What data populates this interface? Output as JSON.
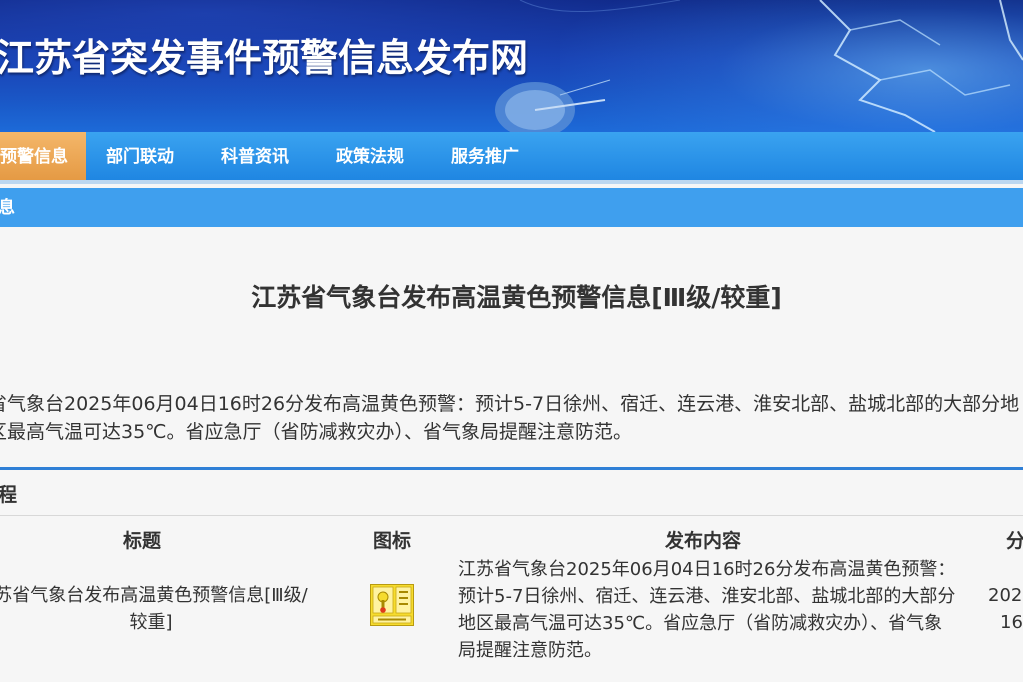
{
  "site": {
    "title": "江苏省突发事件预警信息发布网"
  },
  "nav": {
    "items": [
      {
        "label": "预警信息",
        "active": true
      },
      {
        "label": "部门联动",
        "active": false
      },
      {
        "label": "科普资讯",
        "active": false
      },
      {
        "label": "政策法规",
        "active": false
      },
      {
        "label": "服务推广",
        "active": false
      }
    ]
  },
  "subbar": {
    "label": "息"
  },
  "article": {
    "title": "江苏省气象台发布高温黄色预警信息[Ⅲ级/较重]",
    "body": "省气象台2025年06月04日16时26分发布高温黄色预警：预计5-7日徐州、宿迁、连云港、淮安北部、盐城北部的大部分地区最高气温可达35℃。省应急厅（省防减救灾办）、省气象局提醒注意防范。"
  },
  "process": {
    "heading": "程",
    "columns": [
      "标题",
      "图标",
      "发布内容",
      "分"
    ],
    "rows": [
      {
        "title": "苏省气象台发布高温黄色预警信息[Ⅲ级/较重]",
        "icon": "high-temperature-yellow-warning-icon",
        "content": "江苏省气象台2025年06月04日16时26分发布高温黄色预警：预计5-7日徐州、宿迁、连云港、淮安北部、盐城北部的大部分地区最高气温可达35℃。省应急厅（省防减救灾办）、省气象局提醒注意防范。",
        "time_line1": "202",
        "time_line2": "16"
      }
    ]
  },
  "colors": {
    "nav_bg": "#2a92e8",
    "nav_active": "#eba552",
    "subbar_bg": "#3f9fee",
    "warning_yellow": "#f6dc2e"
  }
}
